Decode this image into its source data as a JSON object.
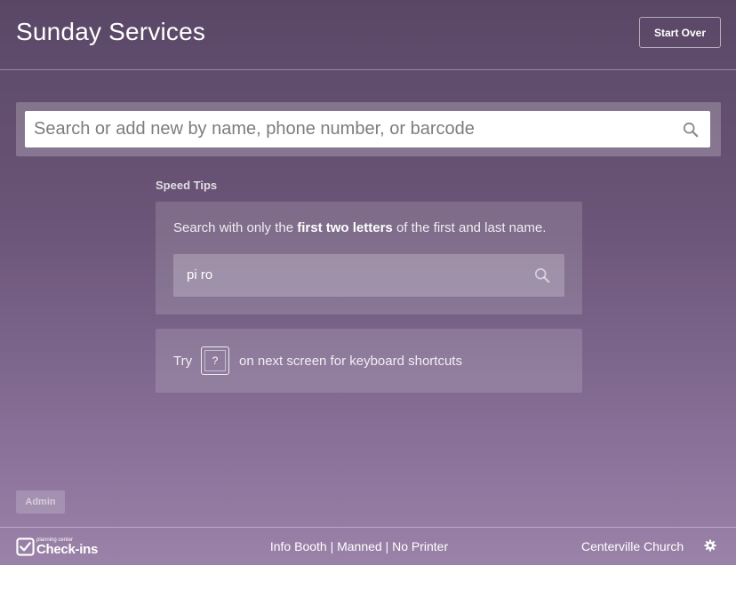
{
  "header": {
    "title": "Sunday Services",
    "start_over_label": "Start Over"
  },
  "search": {
    "placeholder": "Search or add new by name, phone number, or barcode",
    "value": "",
    "icon": "search-icon"
  },
  "speed_tips": {
    "label": "Speed Tips",
    "tip_prefix": "Search with only the ",
    "tip_bold": "first two letters",
    "tip_suffix": " of the first and last name.",
    "example_value": "pi ro",
    "shortcut_try": "Try",
    "shortcut_key": "?",
    "shortcut_rest": "on next screen for keyboard shortcuts"
  },
  "admin": {
    "label": "Admin"
  },
  "footer": {
    "logo_small": "planning center",
    "logo_big": "Check-ins",
    "station": "Info Booth | Manned | No Printer",
    "church": "Centerville Church",
    "settings_icon": "gear-icon"
  },
  "colors": {
    "background_top": "#5a4766",
    "background_bottom": "#9a82a8"
  }
}
